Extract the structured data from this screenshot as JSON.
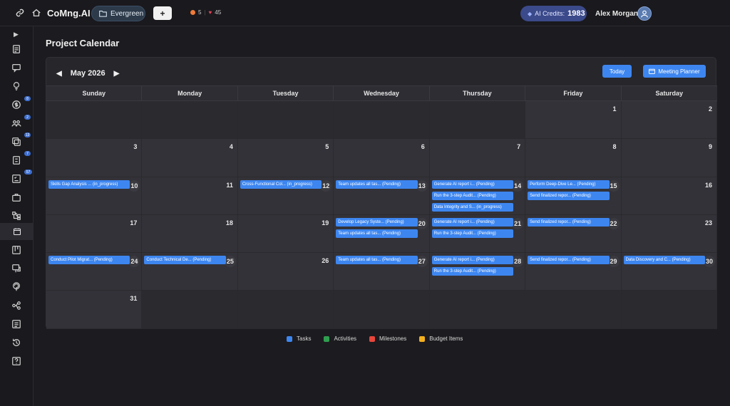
{
  "app": {
    "brand": "CoMng.AI",
    "project": "Evergreen",
    "add_label": "+"
  },
  "stats": {
    "alerts": "5",
    "likes": "45"
  },
  "credits": {
    "label": "AI Credits:",
    "value": "1983"
  },
  "user": {
    "name": "Alex Morgan"
  },
  "sidebar": {
    "badges": [
      "8",
      "2",
      "13",
      "7",
      "57"
    ]
  },
  "page": {
    "title": "Project Calendar"
  },
  "calendar": {
    "month_label": "May 2026",
    "prev": "◀",
    "next": "▶",
    "today_label": "Today",
    "planner_label": "Meeting Planner",
    "weekdays": [
      "Sunday",
      "Monday",
      "Tuesday",
      "Wednesday",
      "Thursday",
      "Friday",
      "Saturday"
    ],
    "weeks": [
      [
        {
          "day": ""
        },
        {
          "day": ""
        },
        {
          "day": ""
        },
        {
          "day": ""
        },
        {
          "day": ""
        },
        {
          "day": "1"
        },
        {
          "day": "2"
        }
      ],
      [
        {
          "day": "3"
        },
        {
          "day": "4"
        },
        {
          "day": "5"
        },
        {
          "day": "6"
        },
        {
          "day": "7"
        },
        {
          "day": "8"
        },
        {
          "day": "9"
        }
      ],
      [
        {
          "day": "10",
          "events": [
            "Skills Gap Analysis ... (in_progress)"
          ]
        },
        {
          "day": "11"
        },
        {
          "day": "12",
          "events": [
            "Cross-Functional Col... (in_progress)"
          ]
        },
        {
          "day": "13",
          "events": [
            "Team updates all tas... (Pending)"
          ]
        },
        {
          "day": "14",
          "events": [
            "Generate AI report i... (Pending)",
            "Run the 3-step Audit... (Pending)",
            "Data Integrity and S... (in_progress)"
          ]
        },
        {
          "day": "15",
          "events": [
            "Perform Deep-Dive Le... (Pending)",
            "Send finalized repor... (Pending)"
          ]
        },
        {
          "day": "16"
        }
      ],
      [
        {
          "day": "17"
        },
        {
          "day": "18"
        },
        {
          "day": "19"
        },
        {
          "day": "20",
          "events": [
            "Develop Legacy Syste... (Pending)",
            "Team updates all tas... (Pending)"
          ]
        },
        {
          "day": "21",
          "events": [
            "Generate AI report i... (Pending)",
            "Run the 3-step Audit... (Pending)"
          ]
        },
        {
          "day": "22",
          "events": [
            "Send finalized repor... (Pending)"
          ]
        },
        {
          "day": "23"
        }
      ],
      [
        {
          "day": "24",
          "events": [
            "Conduct Pilot Migrat... (Pending)"
          ]
        },
        {
          "day": "25",
          "events": [
            "Conduct Technical De... (Pending)"
          ]
        },
        {
          "day": "26"
        },
        {
          "day": "27",
          "events": [
            "Team updates all tas... (Pending)"
          ]
        },
        {
          "day": "28",
          "events": [
            "Generate AI report i... (Pending)",
            "Run the 3-step Audit... (Pending)"
          ]
        },
        {
          "day": "29",
          "events": [
            "Send finalized repor... (Pending)"
          ]
        },
        {
          "day": "30",
          "events": [
            "Data Discovery and C... (Pending)"
          ]
        }
      ],
      [
        {
          "day": "31"
        },
        {
          "day": ""
        },
        {
          "day": ""
        },
        {
          "day": ""
        },
        {
          "day": ""
        },
        {
          "day": ""
        },
        {
          "day": ""
        }
      ]
    ]
  },
  "legend": [
    {
      "label": "Tasks",
      "color": "#3d86f0"
    },
    {
      "label": "Activities",
      "color": "#2f9e4f"
    },
    {
      "label": "Milestones",
      "color": "#e8463a"
    },
    {
      "label": "Budget Items",
      "color": "#f2b01e"
    }
  ]
}
